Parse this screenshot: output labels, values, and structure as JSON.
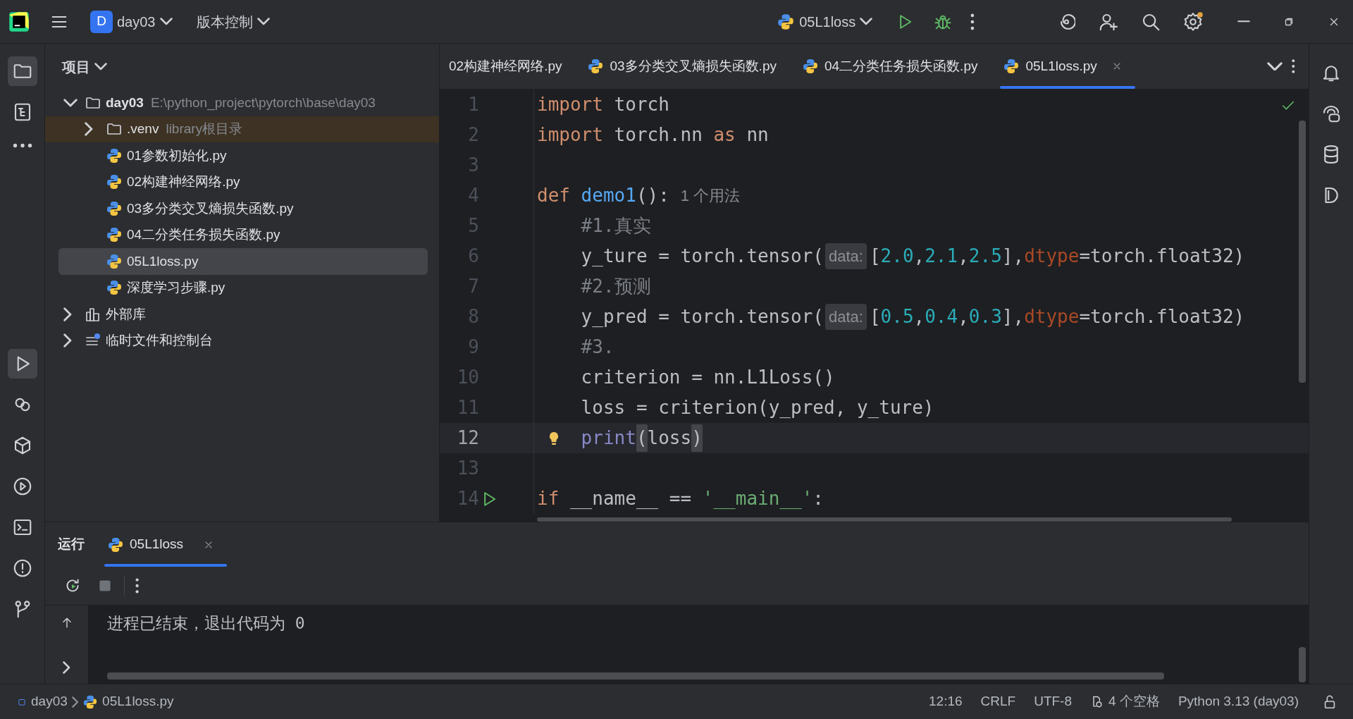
{
  "title_bar": {
    "project_badge": "D",
    "project": "day03",
    "vcs": "版本控制",
    "run_config": "05L1loss"
  },
  "left_tools": {
    "top": [
      {
        "kind": "project",
        "selected": true
      },
      {
        "kind": "structure",
        "selected": false
      },
      {
        "kind": "more",
        "selected": false
      }
    ],
    "bottom": [
      {
        "kind": "run",
        "selected": true
      },
      {
        "kind": "python_console",
        "selected": false
      },
      {
        "kind": "packages",
        "selected": false
      },
      {
        "kind": "services",
        "selected": false
      },
      {
        "kind": "terminal",
        "selected": false
      },
      {
        "kind": "problems",
        "selected": false
      },
      {
        "kind": "git",
        "selected": false
      }
    ]
  },
  "project_panel": {
    "title": "项目",
    "tree": [
      {
        "kind": "folder",
        "name": "day03",
        "hint": "E:\\python_project\\pytorch\\base\\day03",
        "expanded": true,
        "selected": false,
        "children": [
          {
            "kind": "library_folder",
            "name": ".venv",
            "hint": "library根目录",
            "expanded": false,
            "selected": false
          },
          {
            "kind": "python",
            "name": "01参数初始化.py",
            "selected": false
          },
          {
            "kind": "python",
            "name": "02构建神经网络.py",
            "selected": false
          },
          {
            "kind": "python",
            "name": "03多分类交叉熵损失函数.py",
            "selected": false
          },
          {
            "kind": "python",
            "name": "04二分类任务损失函数.py",
            "selected": false
          },
          {
            "kind": "python",
            "name": "05L1loss.py",
            "selected": true
          },
          {
            "kind": "python",
            "name": "深度学习步骤.py",
            "selected": false
          }
        ]
      },
      {
        "kind": "libraries",
        "name": "外部库",
        "expanded": false,
        "selected": false
      },
      {
        "kind": "scratches",
        "name": "临时文件和控制台",
        "expanded": false,
        "selected": false
      }
    ]
  },
  "editor": {
    "tabs": [
      {
        "kind": "cut",
        "label": "02构建神经网络.py",
        "selected": false
      },
      {
        "kind": "python",
        "label": "03多分类交叉熵损失函数.py",
        "selected": false
      },
      {
        "kind": "python",
        "label": "04二分类任务损失函数.py",
        "selected": false
      },
      {
        "kind": "python",
        "label": "05L1loss.py",
        "selected": true
      }
    ],
    "lines": [
      {
        "number": "1",
        "current": false,
        "tokens": [
          {
            "kind": "keyword",
            "text": "import"
          },
          {
            "kind": "plain",
            "text": " torch"
          }
        ]
      },
      {
        "number": "2",
        "current": false,
        "tokens": [
          {
            "kind": "keyword",
            "text": "import"
          },
          {
            "kind": "plain",
            "text": " torch.nn "
          },
          {
            "kind": "keyword",
            "text": "as"
          },
          {
            "kind": "plain",
            "text": " nn"
          }
        ]
      },
      {
        "number": "3",
        "current": false
      },
      {
        "number": "4",
        "current": false,
        "tokens": [
          {
            "kind": "keyword",
            "text": "def"
          },
          {
            "kind": "function",
            "text": " demo1"
          },
          {
            "kind": "plain",
            "text": "():"
          },
          {
            "kind": "usage",
            "text": "1 个用法"
          }
        ]
      },
      {
        "number": "5",
        "current": false,
        "tokens": [
          {
            "kind": "comment",
            "text": "    #1.真实"
          }
        ]
      },
      {
        "number": "6",
        "current": false,
        "tokens": [
          {
            "kind": "plain",
            "text": "    y_ture = torch.tensor("
          },
          {
            "kind": "hint",
            "text": "data:"
          },
          {
            "kind": "plain",
            "text": "["
          },
          {
            "kind": "number",
            "text": "2.0"
          },
          {
            "kind": "plain",
            "text": ","
          },
          {
            "kind": "number",
            "text": "2.1"
          },
          {
            "kind": "plain",
            "text": ","
          },
          {
            "kind": "number",
            "text": "2.5"
          },
          {
            "kind": "plain",
            "text": "],"
          },
          {
            "kind": "param",
            "text": "dtype"
          },
          {
            "kind": "plain",
            "text": "=torch.float32)"
          }
        ]
      },
      {
        "number": "7",
        "current": false,
        "tokens": [
          {
            "kind": "comment",
            "text": "    #2.预测"
          }
        ]
      },
      {
        "number": "8",
        "current": false,
        "tokens": [
          {
            "kind": "plain",
            "text": "    y_pred = torch.tensor("
          },
          {
            "kind": "hint",
            "text": "data:"
          },
          {
            "kind": "plain",
            "text": "["
          },
          {
            "kind": "number",
            "text": "0.5"
          },
          {
            "kind": "plain",
            "text": ","
          },
          {
            "kind": "number",
            "text": "0.4"
          },
          {
            "kind": "plain",
            "text": ","
          },
          {
            "kind": "number",
            "text": "0.3"
          },
          {
            "kind": "plain",
            "text": "],"
          },
          {
            "kind": "param",
            "text": "dtype"
          },
          {
            "kind": "plain",
            "text": "=torch.float32)"
          }
        ]
      },
      {
        "number": "9",
        "current": false,
        "tokens": [
          {
            "kind": "comment",
            "text": "    #3."
          }
        ]
      },
      {
        "number": "10",
        "current": false,
        "tokens": [
          {
            "kind": "plain",
            "text": "    criterion = nn.L1Loss()"
          }
        ]
      },
      {
        "number": "11",
        "current": false,
        "tokens": [
          {
            "kind": "plain",
            "text": "    loss = criterion(y_pred, y_ture)"
          }
        ]
      },
      {
        "number": "12",
        "current": true,
        "kind": "bulb",
        "tokens": [
          {
            "kind": "builtin",
            "text": "    print"
          },
          {
            "kind": "brace",
            "text": "("
          },
          {
            "kind": "plain",
            "text": "loss"
          },
          {
            "kind": "brace",
            "text": ")"
          }
        ]
      },
      {
        "number": "13",
        "current": false
      },
      {
        "number": "14",
        "current": false,
        "kind": "run",
        "tokens": [
          {
            "kind": "keyword",
            "text": "if"
          },
          {
            "kind": "plain",
            "text": " __name__ == "
          },
          {
            "kind": "string",
            "text": "'__main__'"
          },
          {
            "kind": "plain",
            "text": ":"
          }
        ]
      }
    ]
  },
  "run_panel": {
    "title": "运行",
    "tabs": [
      {
        "label": "05L1loss",
        "selected": true
      }
    ],
    "output": "进程已结束，退出代码为 0"
  },
  "status_bar": {
    "breadcrumb": [
      "day03",
      "05L1loss.py"
    ],
    "items": [
      {
        "kind": "text",
        "text": "12:16"
      },
      {
        "kind": "text",
        "text": "CRLF"
      },
      {
        "kind": "text",
        "text": "UTF-8"
      },
      {
        "kind": "indent",
        "text": "4 个空格"
      },
      {
        "kind": "text",
        "text": "Python 3.13 (day03)"
      }
    ]
  }
}
